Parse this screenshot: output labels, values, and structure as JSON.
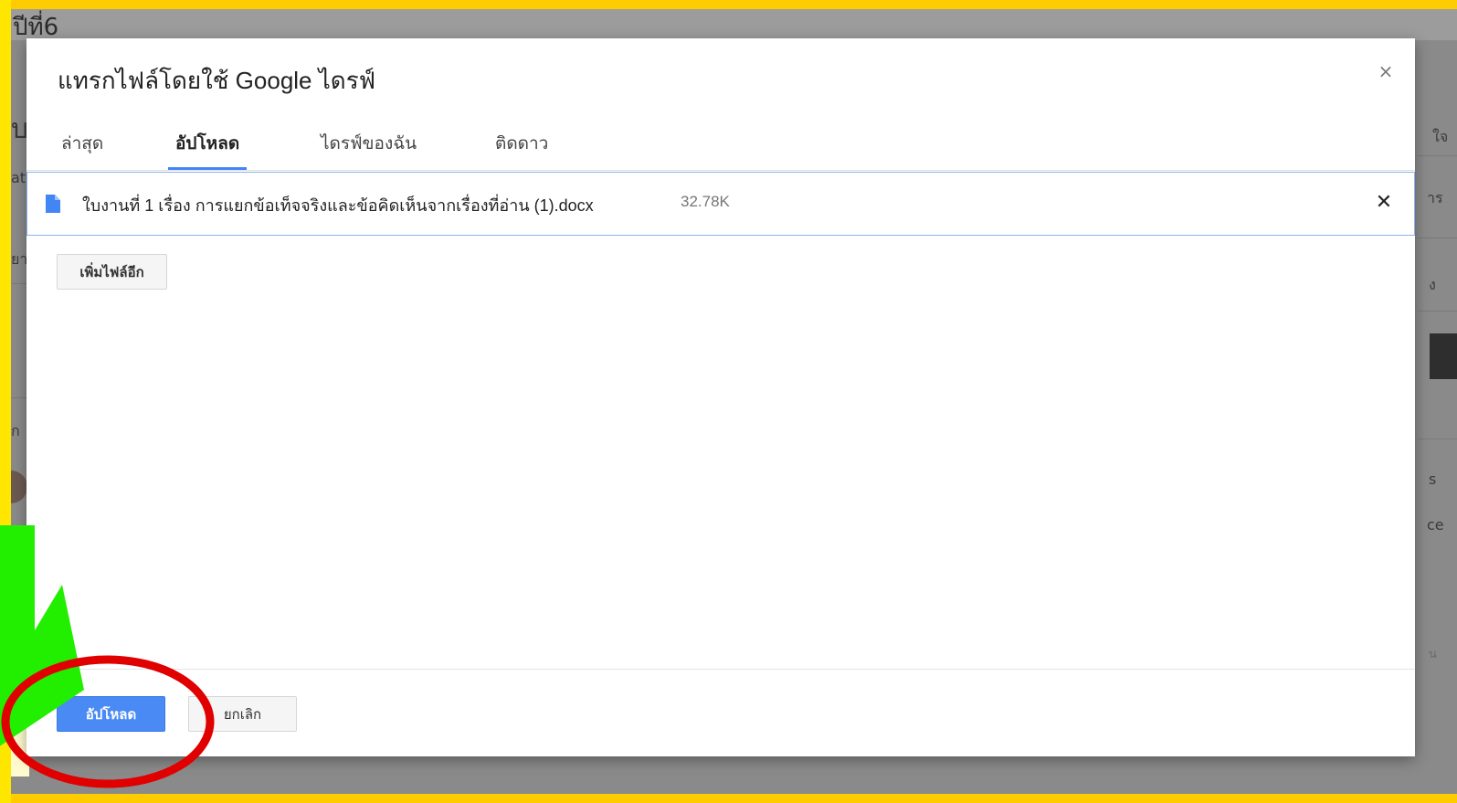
{
  "background": {
    "page_heading": "ปีที่6",
    "fragments": [
      "บ",
      "at",
      "ยา",
      "ก",
      "ใจ",
      "าร",
      "ง",
      "s",
      "ce",
      "น"
    ]
  },
  "dialog": {
    "title": "แทรกไฟล์โดยใช้ Google ไดรฟ์",
    "close_symbol": "×",
    "tabs": [
      {
        "label": "ล่าสุด",
        "active": false
      },
      {
        "label": "อัปโหลด",
        "active": true
      },
      {
        "label": "ไดรฟ์ของฉัน",
        "active": false
      },
      {
        "label": "ติดดาว",
        "active": false
      }
    ],
    "file": {
      "name": "ใบงานที่ 1 เรื่อง การแยกข้อเท็จจริงและข้อคิดเห็นจากเรื่องที่อ่าน (1).docx",
      "size": "32.78K",
      "icon": "document-icon",
      "remove_symbol": "✕"
    },
    "add_more_label": "เพิ่มไฟล์อีก",
    "footer": {
      "upload_label": "อัปโหลด",
      "cancel_label": "ยกเลิก"
    }
  },
  "colors": {
    "frame": "#ffcc00",
    "accent_blue": "#4285f4",
    "annotation_arrow": "#22ee00",
    "annotation_circle": "#e00000"
  }
}
